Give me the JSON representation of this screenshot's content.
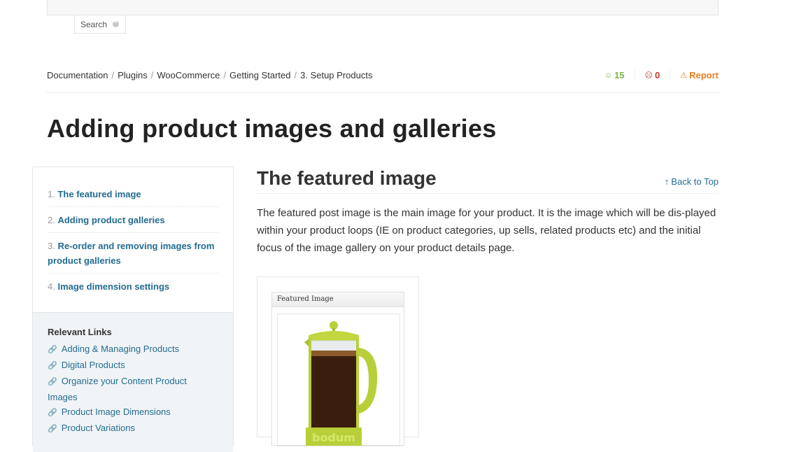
{
  "search": {
    "label": "Search"
  },
  "breadcrumb": {
    "items": [
      "Documentation",
      "Plugins",
      "WooCommerce",
      "Getting Started",
      "3. Setup Products"
    ],
    "separator": "/"
  },
  "votes": {
    "up": "15",
    "down": "0",
    "report_label": "Report"
  },
  "page": {
    "title": "Adding product images and galleries"
  },
  "toc": {
    "items": [
      {
        "num": "1.",
        "label": "The featured image"
      },
      {
        "num": "2.",
        "label": "Adding product galleries"
      },
      {
        "num": "3.",
        "label": "Re-order and removing images from product galleries"
      },
      {
        "num": "4.",
        "label": "Image dimension settings"
      }
    ]
  },
  "related": {
    "heading": "Relevant Links",
    "links": [
      "Adding & Managing Products",
      "Digital Products",
      "Organize your Content Product Images",
      "Product Image Dimensions",
      "Product Variations"
    ]
  },
  "section": {
    "title": "The featured image",
    "back_to_top": "Back to Top",
    "paragraph": "The featured post image is the main image for your product. It is the image which will be dis-played within your product loops (IE on product categories, up sells, related products etc) and the initial focus of the image gallery on your product details page."
  },
  "figure": {
    "box_title": "Featured Image",
    "brand_text": "bodum"
  },
  "colors": {
    "link": "#236c8f",
    "up": "#7ab648",
    "down": "#c0392b",
    "report": "#e67e22"
  }
}
